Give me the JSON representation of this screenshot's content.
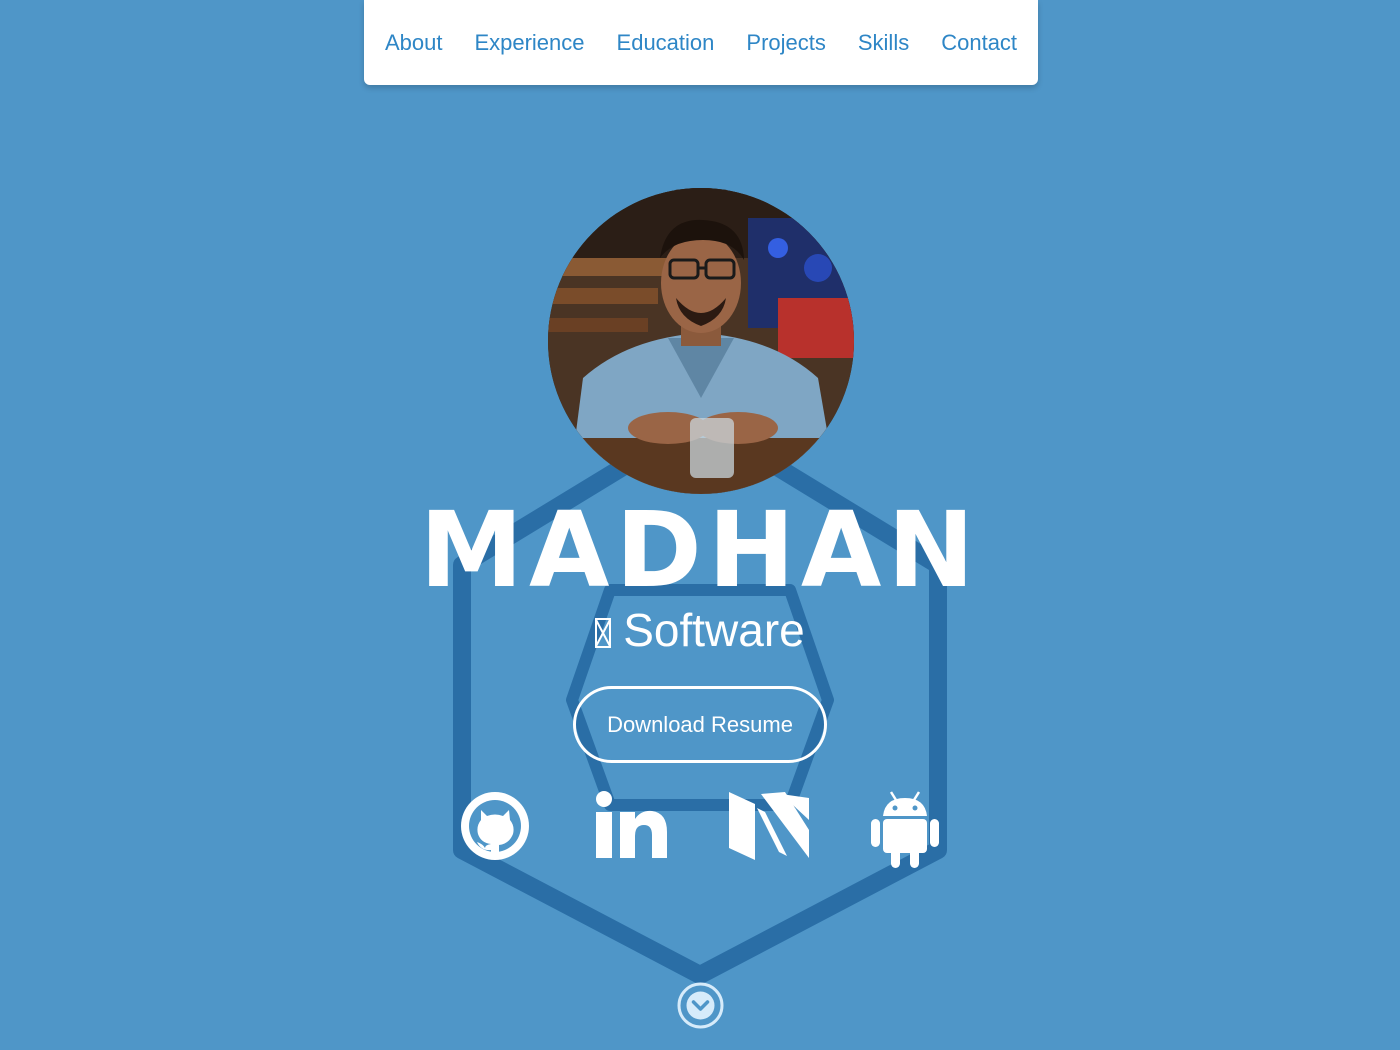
{
  "nav": {
    "items": [
      {
        "label": "About"
      },
      {
        "label": "Experience"
      },
      {
        "label": "Education"
      },
      {
        "label": "Projects"
      },
      {
        "label": "Skills"
      },
      {
        "label": "Contact"
      }
    ]
  },
  "hero": {
    "name": "MADHAN",
    "subtitle": "Software",
    "resume_button": "Download Resume",
    "avatar_alt": "profile-photo"
  },
  "social": {
    "links": [
      {
        "icon": "github-icon"
      },
      {
        "icon": "linkedin-icon"
      },
      {
        "icon": "medium-icon"
      },
      {
        "icon": "android-icon"
      }
    ]
  },
  "colors": {
    "background": "#4f96c8",
    "hexagon": "#2a6ea6",
    "nav_link": "#2e86c6",
    "text": "#ffffff"
  }
}
